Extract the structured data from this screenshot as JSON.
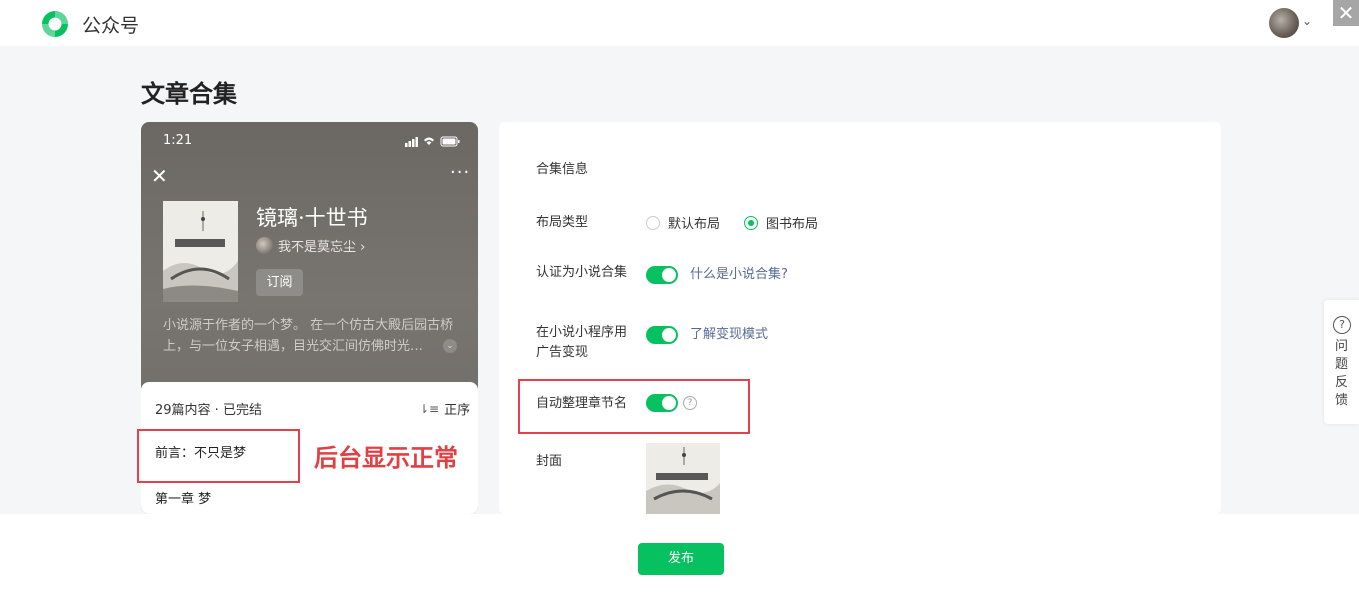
{
  "header": {
    "brand": "公众号",
    "close_glyph": "✕",
    "chevron_glyph": "⌄"
  },
  "page": {
    "title": "文章合集"
  },
  "preview": {
    "time": "1:21",
    "close_glyph": "✕",
    "more_glyph": "···",
    "book_title": "镜璃·十世书",
    "author": "我不是莫忘尘 ›",
    "subscribe": "订阅",
    "description": "小说源于作者的一个梦。 在一个仿古大殿后园古桥上，与一位女子相遇，目光交汇间仿佛时光…",
    "desc_toggle": "⌄",
    "meta": "29篇内容 · 已完结",
    "sort_label": "正序",
    "chapters": [
      "前言：不只是梦",
      "第一章 梦"
    ]
  },
  "annotation": "后台显示正常",
  "settings": {
    "section_title": "合集信息",
    "layout_label": "布局类型",
    "layout_options": [
      {
        "label": "默认布局",
        "selected": false
      },
      {
        "label": "图书布局",
        "selected": true
      }
    ],
    "novel_label": "认证为小说合集",
    "novel_link": "什么是小说合集?",
    "ads_label": "在小说小程序用广告变现",
    "ads_link": "了解变现模式",
    "auto_label": "自动整理章节名",
    "cover_label": "封面",
    "toggles": {
      "novel": true,
      "ads": true,
      "auto": true
    }
  },
  "feedback": {
    "label": "问题反馈"
  },
  "footer": {
    "publish": "发布"
  },
  "colors": {
    "accent": "#07c160",
    "link": "#576b95",
    "annotation": "#e23f43"
  }
}
